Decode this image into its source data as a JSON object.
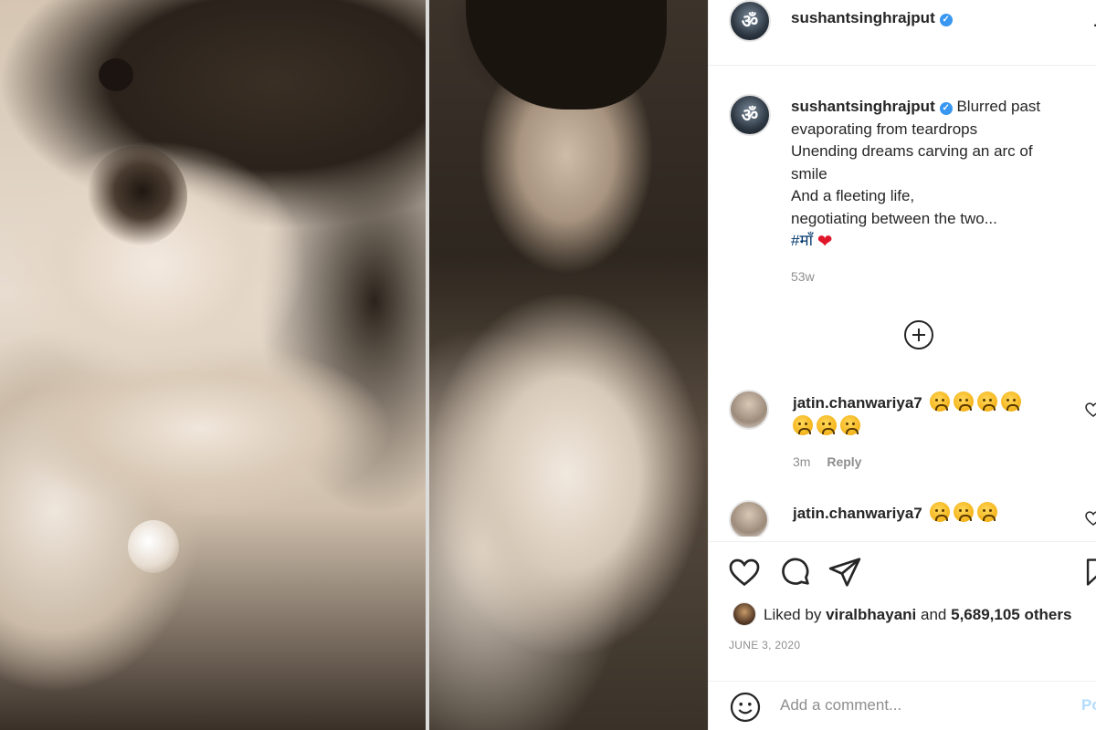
{
  "post": {
    "username": "sushantsinghrajput",
    "avatar_glyph": "ॐ",
    "caption_lines": [
      "Blurred past",
      "evaporating from teardrops",
      "Unending dreams carving an arc of",
      "smile",
      "And a fleeting life,",
      "negotiating between the two..."
    ],
    "hashtag": "#माँ",
    "heart_emoji": "❤",
    "caption_time": "53w",
    "more_icon": "ellipsis-icon"
  },
  "comments": [
    {
      "username": "jatin.chanwariya7",
      "emoji_count_line1": 4,
      "emoji_count_line2": 3,
      "time": "3m",
      "reply_label": "Reply"
    },
    {
      "username": "jatin.chanwariya7",
      "emoji_count_line1": 3
    }
  ],
  "actions": {
    "liked_prefix": "Liked by",
    "liked_user": "viralbhayani",
    "liked_and": "and",
    "liked_count": "5,689,105 others",
    "date": "JUNE 3, 2020"
  },
  "add_comment": {
    "placeholder": "Add a comment...",
    "post_label": "Post"
  },
  "colors": {
    "verified_blue": "#3897f0",
    "hashtag_blue": "#00376b",
    "muted_gray": "#8e8e8e",
    "post_button_disabled": "#b3dbff"
  }
}
